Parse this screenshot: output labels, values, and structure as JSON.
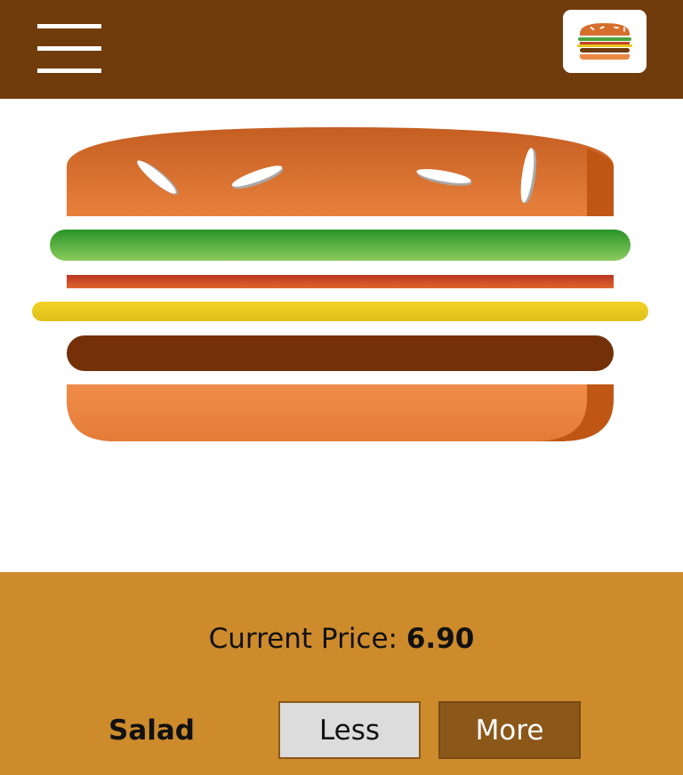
{
  "header": {
    "menu_icon": "hamburger-menu-icon",
    "logo_icon": "burger-logo-icon"
  },
  "burger": {
    "layers": [
      "bun-top",
      "salad",
      "bacon",
      "cheese",
      "meat",
      "bun-bottom"
    ]
  },
  "controls": {
    "price_label": "Current Price:",
    "price_value": "6.90",
    "ingredient_label": "Salad",
    "less_label": "Less",
    "more_label": "More"
  },
  "colors": {
    "header_bg": "#713c0b",
    "controls_bg": "#cd8b2c",
    "more_button_bg": "#8b581a",
    "less_button_bg": "#dcdcdc"
  }
}
